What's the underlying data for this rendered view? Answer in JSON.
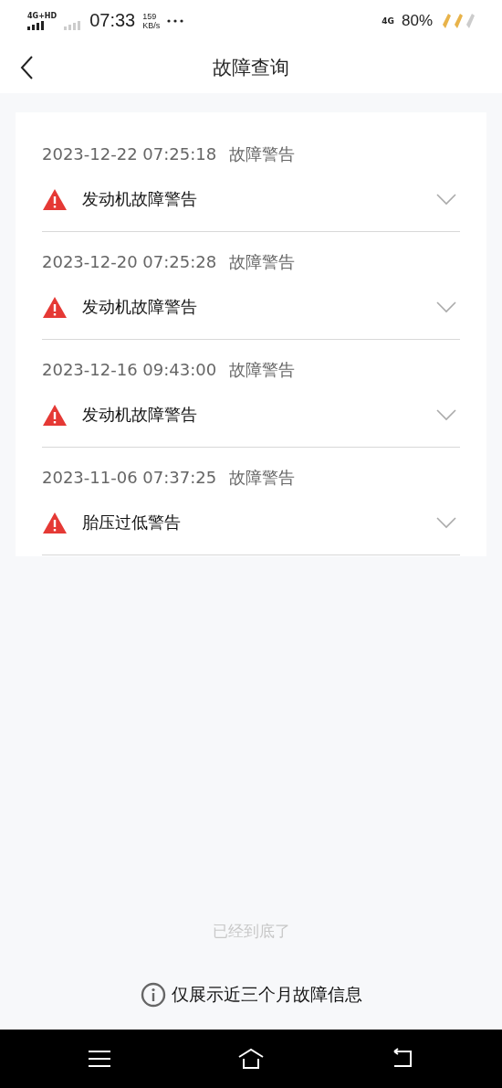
{
  "status_bar": {
    "network_left": "4G+HD",
    "time": "07:33",
    "speed_value": "159",
    "speed_unit": "KB/s",
    "network_right": "4G",
    "battery": "80%"
  },
  "header": {
    "title": "故障查询"
  },
  "records": [
    {
      "time": "2023-12-22 07:25:18",
      "type": "故障警告",
      "title": "发动机故障警告",
      "expanded": false
    },
    {
      "time": "2023-12-20 07:25:28",
      "type": "故障警告",
      "title": "发动机故障警告",
      "expanded": false
    },
    {
      "time": "2023-12-16 09:43:00",
      "type": "故障警告",
      "title": "发动机故障警告",
      "expanded": false
    },
    {
      "time": "2023-11-06 07:37:25",
      "type": "故障警告",
      "title": "胎压过低警告",
      "expanded": false
    }
  ],
  "end_text": "已经到底了",
  "notice": "仅展示近三个月故障信息"
}
